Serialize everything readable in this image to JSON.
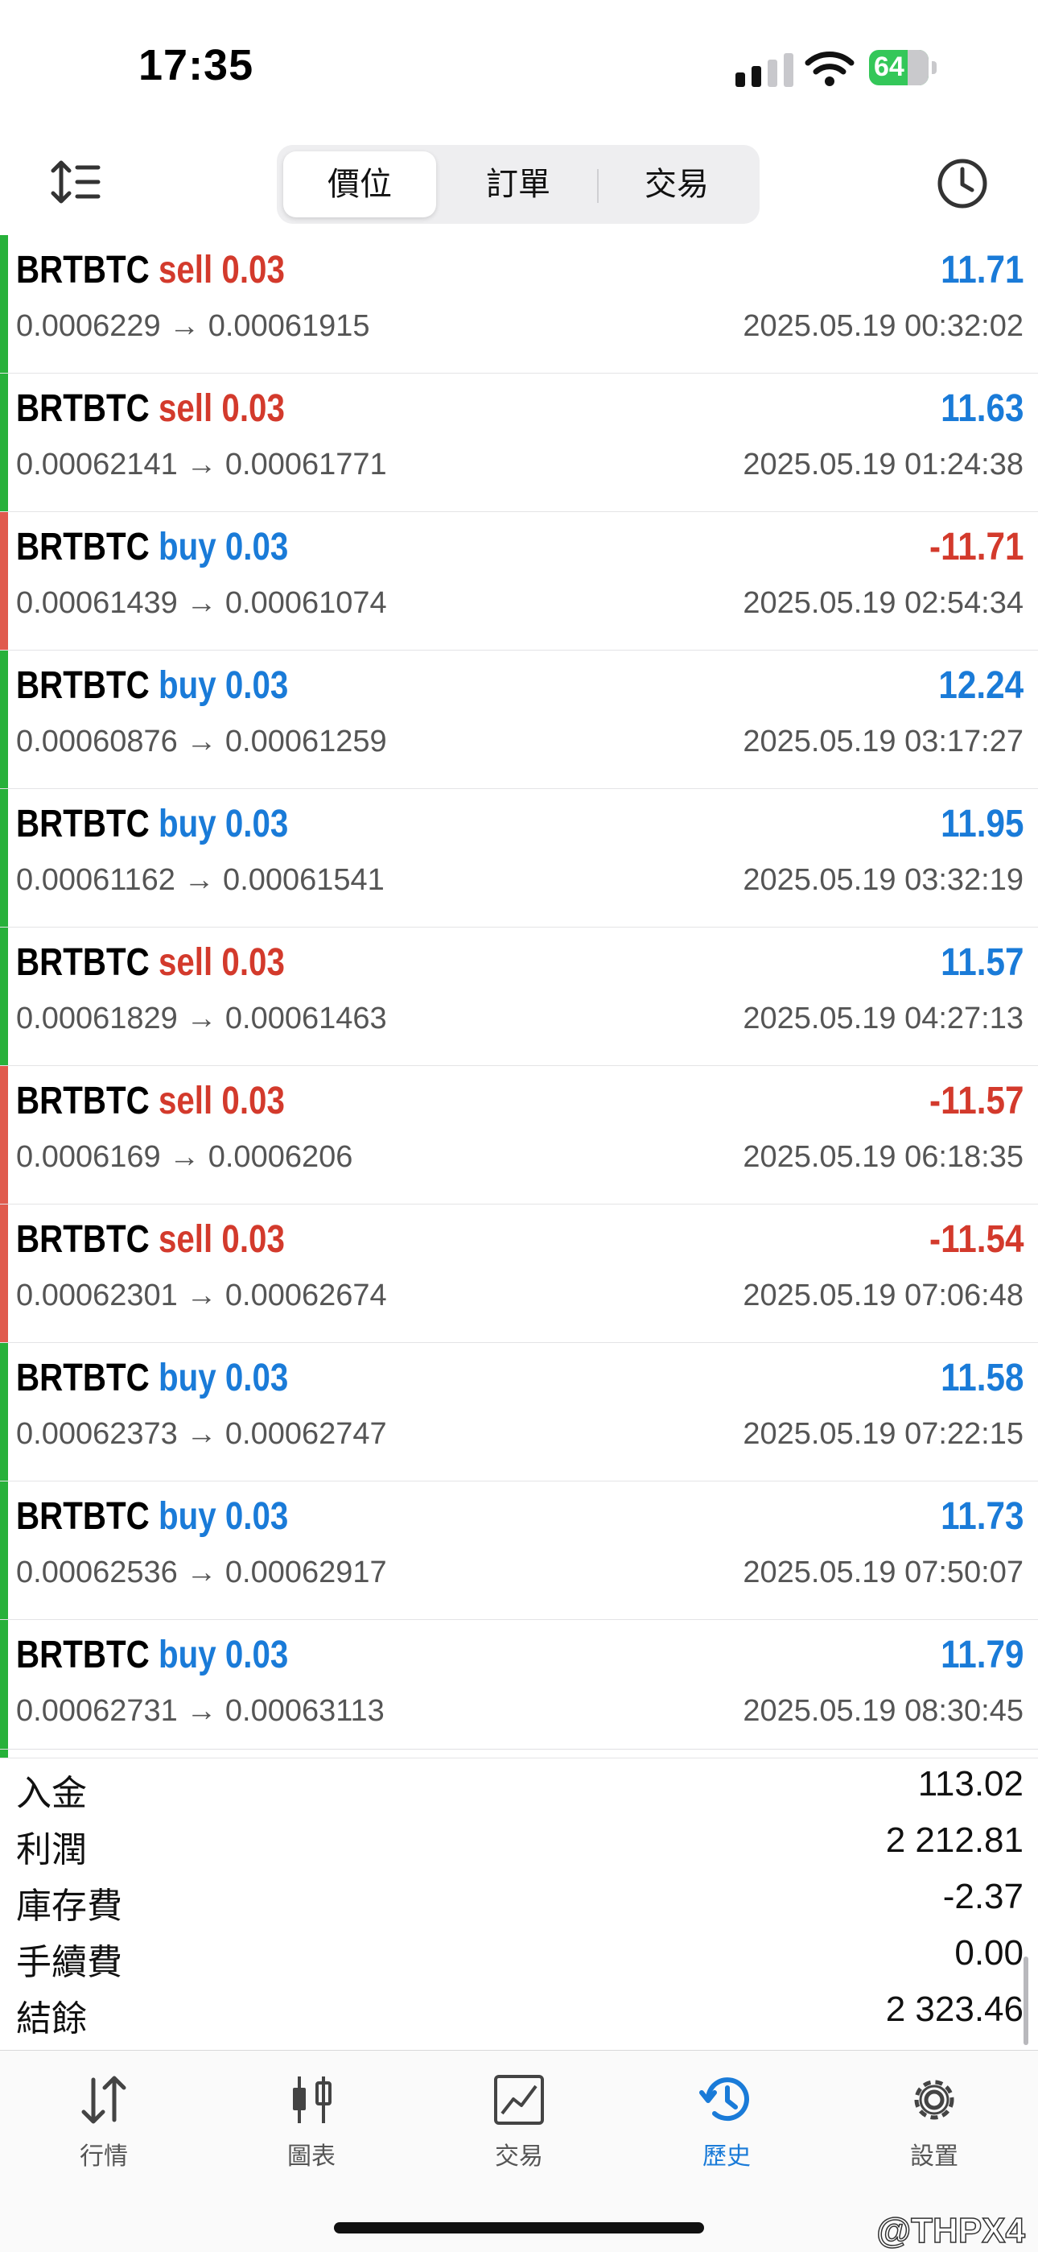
{
  "status": {
    "time": "17:35",
    "battery": "64"
  },
  "header": {
    "tabs": [
      {
        "label": "價位",
        "active": true
      },
      {
        "label": "訂單",
        "active": false
      },
      {
        "label": "交易",
        "active": false
      }
    ]
  },
  "colors": {
    "win_bar": "#27b13a",
    "loss_bar": "#e05a4d",
    "sell": "#d33a2c",
    "buy": "#1a7bd8",
    "accent": "#1a7bd8"
  },
  "trades": [
    {
      "symbol": "BRTBTC",
      "side": "sell",
      "volume": "0.03",
      "prices": "0.0006229 → 0.00061915",
      "profit": "11.71",
      "date": "2025.05.19 00:32:02"
    },
    {
      "symbol": "BRTBTC",
      "side": "sell",
      "volume": "0.03",
      "prices": "0.00062141 → 0.00061771",
      "profit": "11.63",
      "date": "2025.05.19 01:24:38"
    },
    {
      "symbol": "BRTBTC",
      "side": "buy",
      "volume": "0.03",
      "prices": "0.00061439 → 0.00061074",
      "profit": "-11.71",
      "date": "2025.05.19 02:54:34"
    },
    {
      "symbol": "BRTBTC",
      "side": "buy",
      "volume": "0.03",
      "prices": "0.00060876 → 0.00061259",
      "profit": "12.24",
      "date": "2025.05.19 03:17:27"
    },
    {
      "symbol": "BRTBTC",
      "side": "buy",
      "volume": "0.03",
      "prices": "0.00061162 → 0.00061541",
      "profit": "11.95",
      "date": "2025.05.19 03:32:19"
    },
    {
      "symbol": "BRTBTC",
      "side": "sell",
      "volume": "0.03",
      "prices": "0.00061829 → 0.00061463",
      "profit": "11.57",
      "date": "2025.05.19 04:27:13"
    },
    {
      "symbol": "BRTBTC",
      "side": "sell",
      "volume": "0.03",
      "prices": "0.0006169 → 0.0006206",
      "profit": "-11.57",
      "date": "2025.05.19 06:18:35"
    },
    {
      "symbol": "BRTBTC",
      "side": "sell",
      "volume": "0.03",
      "prices": "0.00062301 → 0.00062674",
      "profit": "-11.54",
      "date": "2025.05.19 07:06:48"
    },
    {
      "symbol": "BRTBTC",
      "side": "buy",
      "volume": "0.03",
      "prices": "0.00062373 → 0.00062747",
      "profit": "11.58",
      "date": "2025.05.19 07:22:15"
    },
    {
      "symbol": "BRTBTC",
      "side": "buy",
      "volume": "0.03",
      "prices": "0.00062536 → 0.00062917",
      "profit": "11.73",
      "date": "2025.05.19 07:50:07"
    },
    {
      "symbol": "BRTBTC",
      "side": "buy",
      "volume": "0.03",
      "prices": "0.00062731 → 0.00063113",
      "profit": "11.79",
      "date": "2025.05.19 08:30:45"
    }
  ],
  "summary": [
    {
      "label": "入金",
      "value": "113.02"
    },
    {
      "label": "利潤",
      "value": "2 212.81"
    },
    {
      "label": "庫存費",
      "value": "-2.37"
    },
    {
      "label": "手續費",
      "value": "0.00"
    },
    {
      "label": "結餘",
      "value": "2 323.46"
    }
  ],
  "tabbar": [
    {
      "label": "行情",
      "icon": "arrows-updown-icon",
      "active": false
    },
    {
      "label": "圖表",
      "icon": "candlestick-icon",
      "active": false
    },
    {
      "label": "交易",
      "icon": "trade-chart-icon",
      "active": false
    },
    {
      "label": "歷史",
      "icon": "history-icon",
      "active": true
    },
    {
      "label": "設置",
      "icon": "gear-icon",
      "active": false
    }
  ],
  "watermark": "@THPX4"
}
